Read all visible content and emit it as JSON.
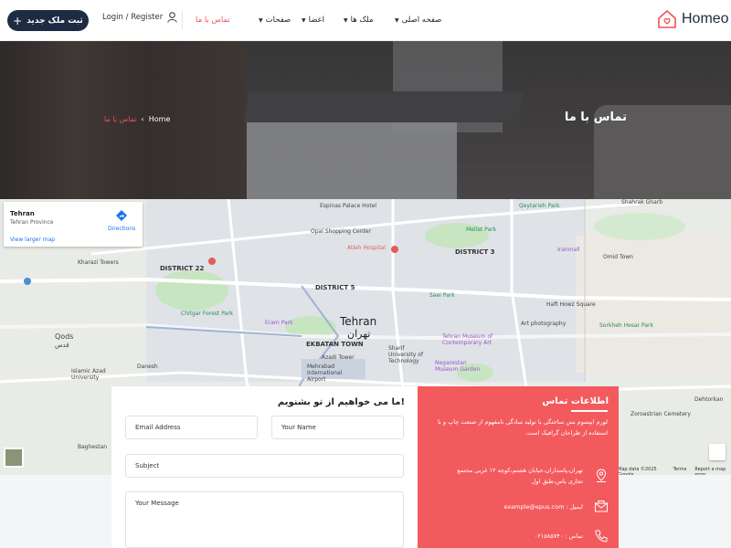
{
  "header": {
    "logo_text": "Homeo",
    "add_property_label": "ثبت ملک جدید",
    "login_label": "Login / Register",
    "nav": [
      {
        "label": "صفحه اصلی",
        "has_dropdown": true
      },
      {
        "label": "ملک ها",
        "has_dropdown": true
      },
      {
        "label": "اعضا",
        "has_dropdown": true
      },
      {
        "label": "صفحات",
        "has_dropdown": true
      },
      {
        "label": "تماس با ما",
        "has_dropdown": false,
        "active": true
      }
    ]
  },
  "hero": {
    "title": "تماس با ما",
    "breadcrumb": {
      "home": "Home",
      "current": "تماس با ما"
    }
  },
  "map": {
    "card": {
      "place": "Tehran",
      "region": "Tehran Province",
      "larger_map": "View larger map",
      "directions": "Directions"
    },
    "city_label": "Tehran",
    "city_label_fa": "تهران",
    "labels": {
      "espinas": "Espinas Palace Hotel",
      "qeytarieh": "Qeytarieh Park",
      "shahrak_gharb": "Shahrak Gharb",
      "opal": "Opal Shopping Center",
      "mellat": "Mellat Park",
      "atieh": "Atieh Hospital",
      "district3": "DISTRICT 3",
      "lalehzar": "Iranmall",
      "kharazi": "Kharazi Towers",
      "district22": "DISTRICT 22",
      "chitgar": "Chitgar Forest Park",
      "district5": "DISTRICT 5",
      "eram": "Eram Park",
      "saei": "Saei Park",
      "omid": "Omid Town",
      "haft_howz": "Haft Howz Square",
      "art_photography": "Art photography",
      "sorkheh_hesar": "Sorkheh Hesar Park",
      "ekbatan": "EKBATAN TOWN",
      "azadi": "Azadi Tower",
      "sharif": "Sharif University of Technology",
      "tmca": "Tehran Museum of Contemporary Art",
      "negarestan": "Negarestan Museum Garden",
      "mehrabad": "Mehrabad International Airport",
      "qods": "Qods",
      "qods_fa": "قدس",
      "danesh": "Danesh",
      "islamic_azad": "Islamic Azad University",
      "bagheshahr": "Baghestan",
      "dehtorkan": "Dehtorkan",
      "zoroastrian": "Zoroastrian Cemetery"
    },
    "footer": {
      "data": "Map data ©2025 Google",
      "terms": "Terms",
      "report": "Report a map error"
    }
  },
  "form": {
    "title": "ما می خواهیم از تو بشنویم!",
    "email_placeholder": "Email Address",
    "name_placeholder": "Your Name",
    "subject_placeholder": "Subject",
    "message_placeholder": "Your Message"
  },
  "contact_info": {
    "title": "اطلاعات تماس",
    "description": "لورم ایپسوم متن ساختگی با تولید سادگی نامفهوم از صنعت چاپ و با استفاده از طراحان گرافیک است.",
    "address": "تهران،پاسداران،خیابان هشتم،کوچه ۱۲ غربی مجتمع تجاری یاس،طبق اول",
    "email": "ایمیل : example@epus.com",
    "phone": "تماس : ۰۲۱۵۸۵۷۴۰"
  },
  "colors": {
    "accent": "#f35a5e",
    "navy": "#1f2a44"
  }
}
